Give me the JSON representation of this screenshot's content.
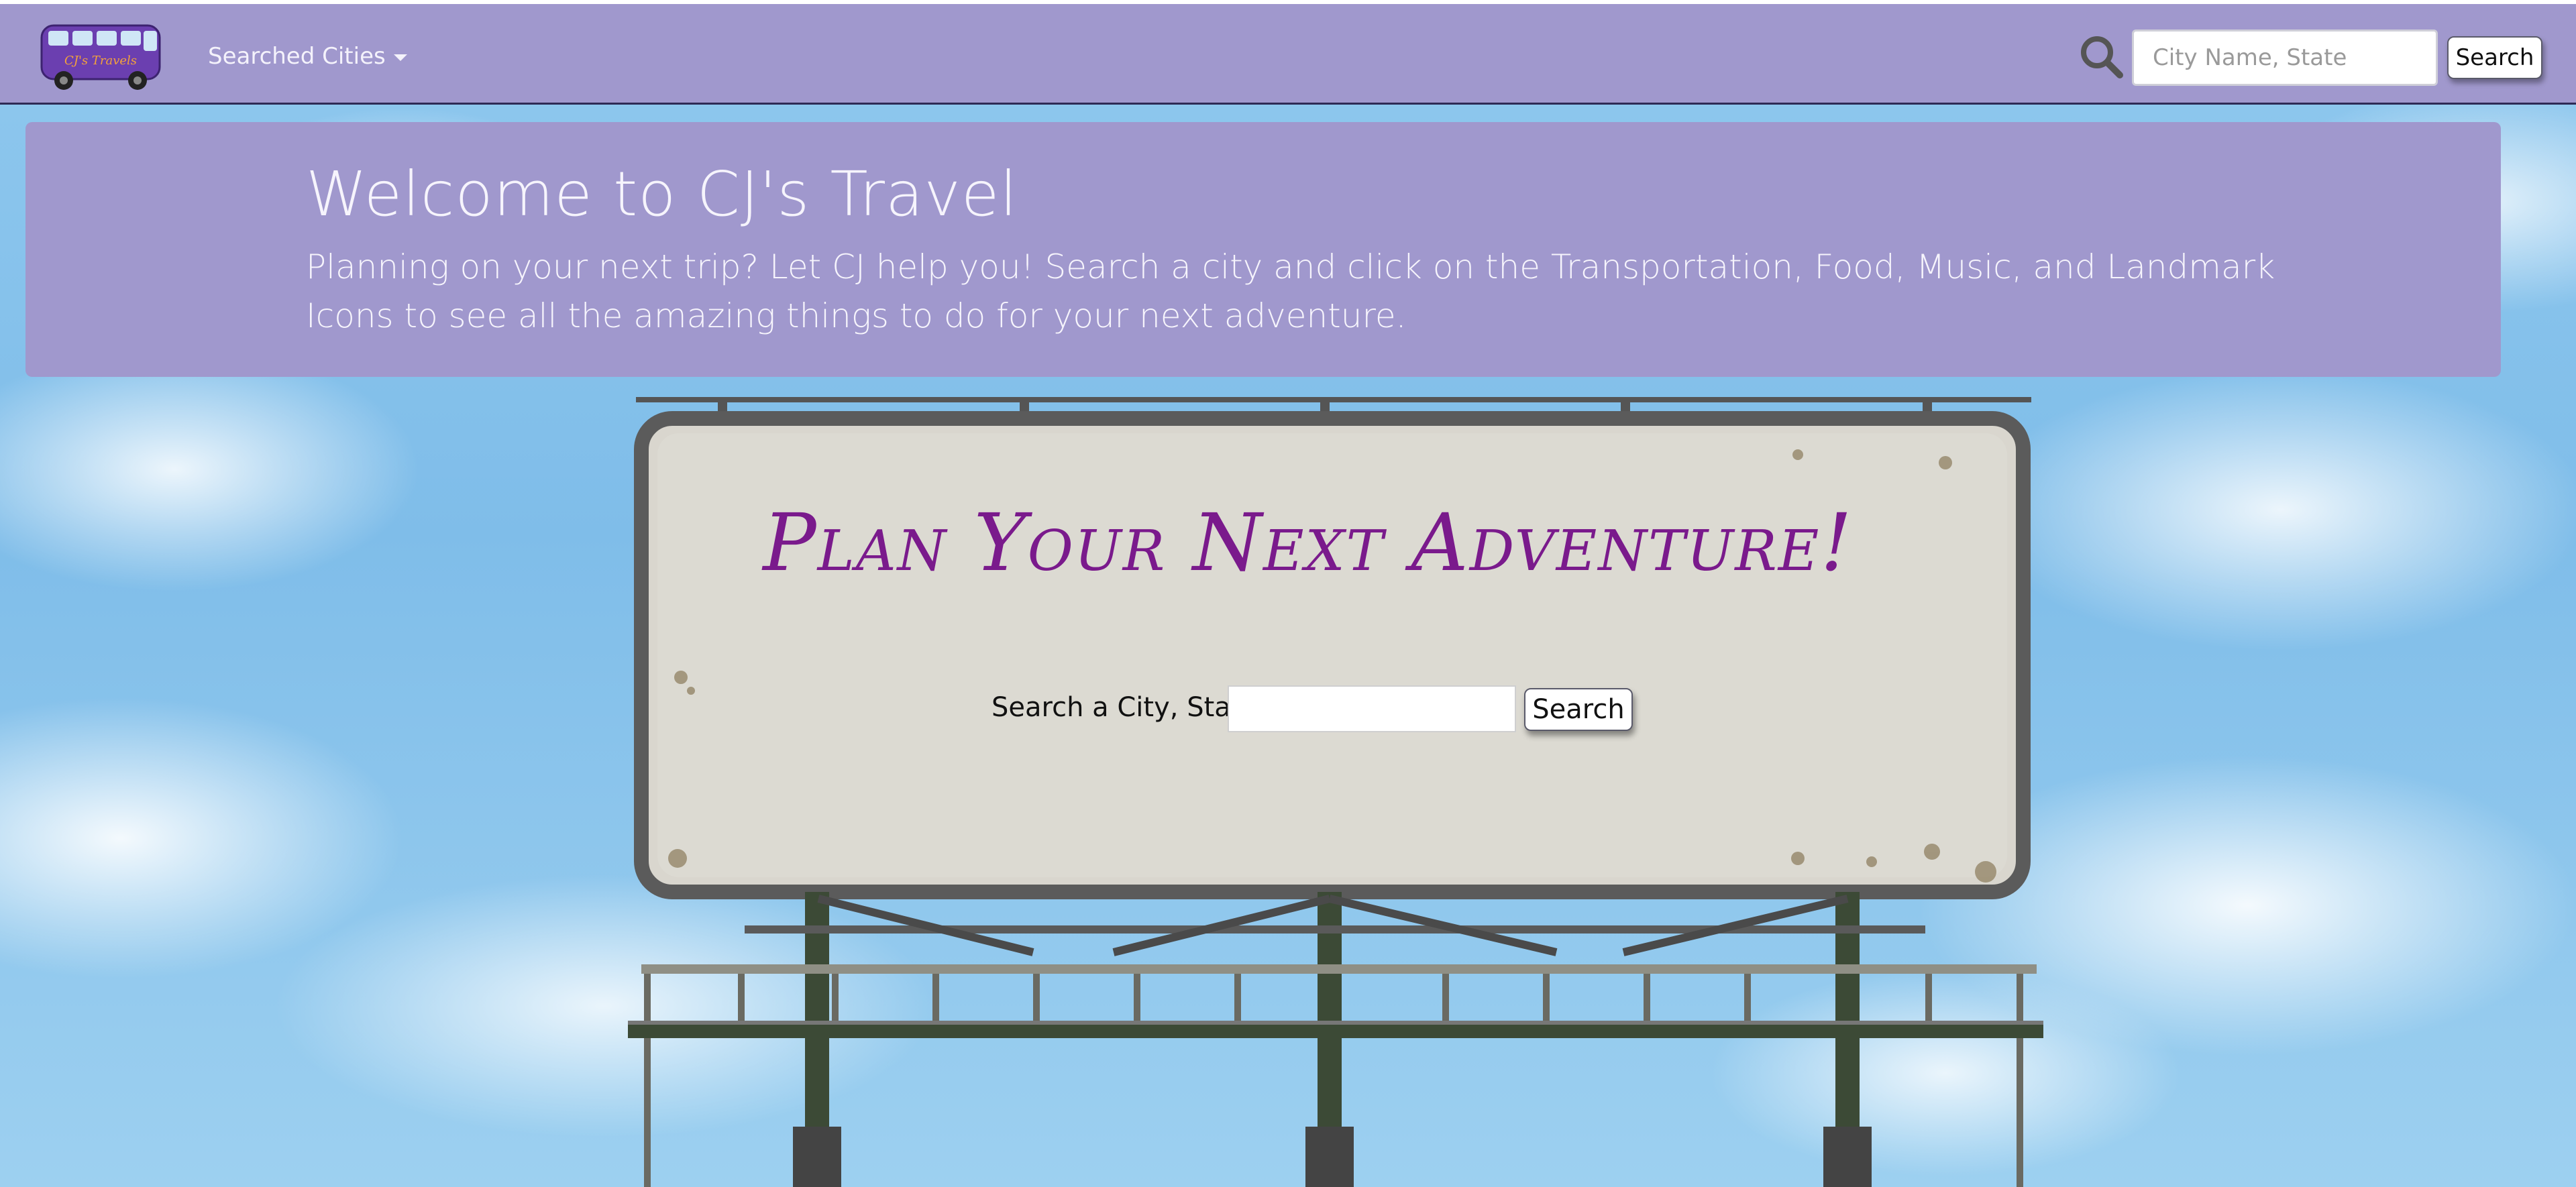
{
  "navbar": {
    "logo_text": "CJ's Travels",
    "dropdown_label": "Searched Cities",
    "search_placeholder": "City Name, State",
    "search_button": "Search"
  },
  "jumbotron": {
    "title": "Welcome to CJ's Travel",
    "description": "Planning on your next trip? Let CJ help you! Search a city and click on the Transportation, Food, Music, and Landmark Icons to see all the amazing things to do for your next adventure."
  },
  "billboard": {
    "title": "Plan Your Next Adventure!",
    "search_label": "Search a City, State",
    "search_value": "",
    "search_button": "Search"
  },
  "colors": {
    "navbar": "#a098cd",
    "jumbotron": "#a098cd",
    "billboard_title": "#7a1a8c",
    "sky": "#8fc8ee"
  }
}
